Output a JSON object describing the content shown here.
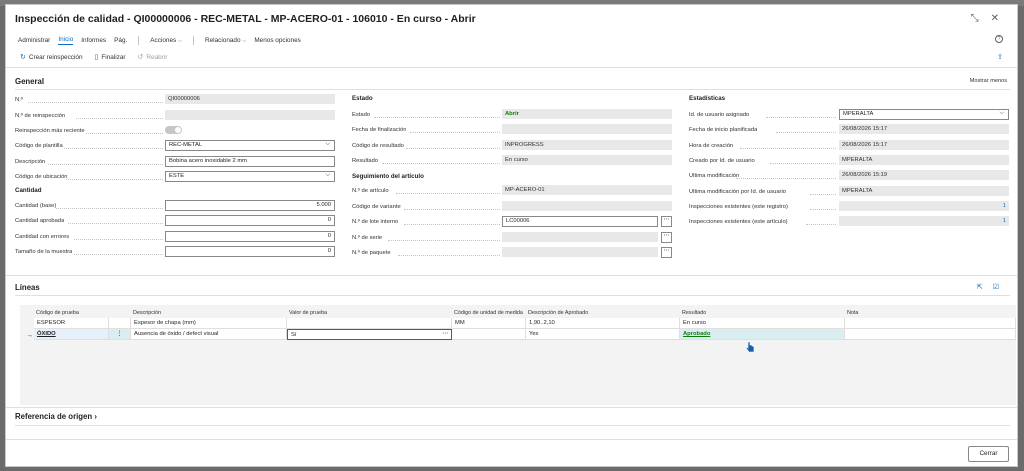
{
  "window": {
    "title": "Inspección de calidad - QI00000006 - REC-METAL - MP-ACERO-01 - 106010 - En curso - Abrir"
  },
  "menu": {
    "items": [
      "Administrar",
      "Inicio",
      "Informes",
      "Pág."
    ],
    "dropdowns": [
      "Acciones",
      "Relacionado"
    ],
    "more": "Menos opciones"
  },
  "actions": {
    "create_reinspection": "Crear reinspección",
    "finalize": "Finalizar",
    "reopen": "Reabrir"
  },
  "general": {
    "title": "General",
    "show_more": "Mostrar menos",
    "left": {
      "no_label": "N.º",
      "no_value": "QI00000006",
      "reinspection_no_label": "N.º de reinspección",
      "reinspection_no_value": "",
      "most_recent_label": "Reinspección más reciente",
      "template_code_label": "Código de plantilla",
      "template_code_value": "REC-METAL",
      "description_label": "Descripción",
      "description_value": "Bobina acero inoxidable 2 mm",
      "location_label": "Código de ubicación",
      "location_value": "ESTE",
      "quantity_title": "Cantidad",
      "qty_base_label": "Cantidad (base)",
      "qty_base_value": "5.000",
      "qty_approved_label": "Cantidad aprobada",
      "qty_approved_value": "0",
      "qty_errors_label": "Cantidad con errores",
      "qty_errors_value": "0",
      "sample_size_label": "Tamaño de la muestra",
      "sample_size_value": "0"
    },
    "middle": {
      "state_title": "Estado",
      "state_label": "Estado",
      "state_value": "Abrir",
      "finish_date_label": "Fecha de finalización",
      "finish_date_value": "",
      "result_code_label": "Código de resultado",
      "result_code_value": "INPROGRESS",
      "result_label": "Resultado",
      "result_value": "En curso",
      "tracking_title": "Seguimiento del artículo",
      "item_no_label": "N.º de artículo",
      "item_no_value": "MP-ACERO-01",
      "variant_label": "Código de variante",
      "variant_value": "",
      "lot_label": "N.º de lote interno",
      "lot_value": "LC00006",
      "serial_label": "N.º de serie",
      "serial_value": "",
      "package_label": "N.º de paquete",
      "package_value": ""
    },
    "right": {
      "stats_title": "Estadísticas",
      "assigned_user_label": "Id. de usuario asignado",
      "assigned_user_value": "MPERALTA",
      "planned_start_label": "Fecha de inicio planificada",
      "planned_start_value": "26/08/2026 15:17",
      "creation_time_label": "Hora de creación",
      "creation_time_value": "26/08/2026 15:17",
      "created_by_label": "Creado por Id. de usuario",
      "created_by_value": "MPERALTA",
      "last_modified_label": "Última modificación",
      "last_modified_value": "26/08/2026 15:19",
      "last_modified_by_label": "Última modificación por Id. de usuario",
      "last_modified_by_value": "MPERALTA",
      "existing_record_label": "Inspecciones existentes (este registro)",
      "existing_record_value": "1",
      "existing_item_label": "Inspecciones existentes (este artículo)",
      "existing_item_value": "1"
    }
  },
  "lines": {
    "title": "Líneas",
    "headers": {
      "test_code": "Código de prueba",
      "description": "Descripción",
      "test_value": "Valor de prueba",
      "uom": "Código de unidad de medida",
      "approved_desc": "Descripción de Aprobado",
      "result": "Resultado",
      "note": "Nota"
    },
    "rows": [
      {
        "test_code": "ESPESOR",
        "description": "Espesor de chapa (mm)",
        "test_value": "",
        "uom": "MM",
        "approved_desc": "1,90..2,10",
        "result": "En curso",
        "note": ""
      },
      {
        "test_code": "ÓXIDO",
        "description": "Ausencia de óxido / defect visual",
        "test_value": "Sí",
        "uom": "",
        "approved_desc": "Yes",
        "result": "Aprobado",
        "note": ""
      }
    ]
  },
  "origin": {
    "title": "Referencia de origen"
  },
  "footer": {
    "close_label": "Cerrar"
  },
  "colors": {
    "accent": "#0f6cbd",
    "approved_green": "#107c10",
    "readonly_bg": "#e8e8e8"
  }
}
